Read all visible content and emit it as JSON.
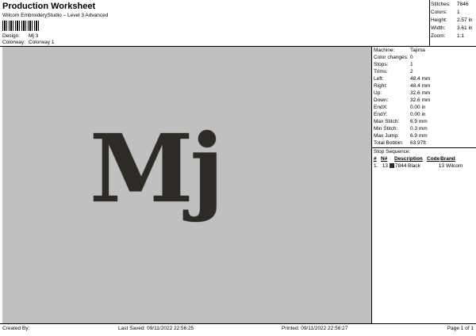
{
  "header": {
    "title": "Production Worksheet",
    "subtitle": "Wilcom EmbroideryStudio – Level 3 Advanced",
    "design_label": "Design:",
    "design_value": "Mj 3",
    "colorway_label": "Colorway:",
    "colorway_value": "Colorway 1"
  },
  "stats": [
    {
      "label": "Stitches:",
      "value": "7846"
    },
    {
      "label": "Colors:",
      "value": "1"
    },
    {
      "label": "Height:",
      "value": "2.57 in"
    },
    {
      "label": "Width:",
      "value": "3.61 in"
    },
    {
      "label": "Zoom:",
      "value": "1:1"
    }
  ],
  "design_text": "Mj",
  "colors": {
    "thread": "#2e2b26",
    "canvas": "#c0c0c0"
  },
  "machine": [
    {
      "label": "Machine:",
      "value": "Tajima"
    },
    {
      "label": "Color changes:",
      "value": "0"
    },
    {
      "label": "Stops:",
      "value": "1"
    },
    {
      "label": "Trims:",
      "value": "2"
    },
    {
      "label": "Left:",
      "value": "48.4 mm"
    },
    {
      "label": "Right:",
      "value": "48.4 mm"
    },
    {
      "label": "Up:",
      "value": "32.6 mm"
    },
    {
      "label": "Down:",
      "value": "32.6 mm"
    },
    {
      "label": "EndX:",
      "value": "0.00 in"
    },
    {
      "label": "EndY:",
      "value": "0.00 in"
    },
    {
      "label": "Max Stitch:",
      "value": "6.9 mm"
    },
    {
      "label": "Min Stitch:",
      "value": "0.3 mm"
    },
    {
      "label": "Max Jump:",
      "value": "6.9 mm"
    },
    {
      "label": "Total Bobbin:",
      "value": "63.97ft"
    }
  ],
  "stop_sequence": {
    "title": "Stop Sequence:",
    "headers": [
      "#",
      "N#",
      "Description",
      "Code",
      "Brand"
    ],
    "rows": [
      {
        "index": "1.",
        "n": "13",
        "stitches": "7844",
        "description": "Black",
        "code": "13",
        "brand": "Wilcom"
      }
    ]
  },
  "footer": {
    "created_by": "Created By:",
    "last_saved": "Last Saved: 09/11/2022 22:56:25",
    "printed": "Printed: 09/11/2022 22:56:27",
    "page": "Page 1 of 1"
  }
}
